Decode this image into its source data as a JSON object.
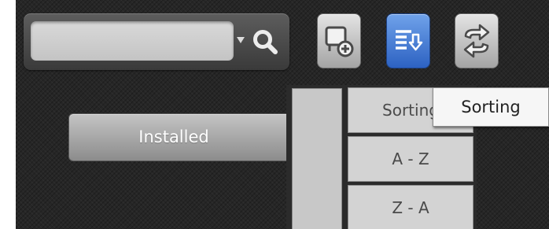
{
  "search": {
    "value": "",
    "placeholder": "",
    "icon": "search-icon",
    "dropdown_icon": "chevron-down-icon"
  },
  "toolbar": {
    "buttons": [
      {
        "icon": "add-window-icon",
        "style": "grey"
      },
      {
        "icon": "sort-list-icon",
        "style": "blue",
        "active": true
      },
      {
        "icon": "swap-arrows-icon",
        "style": "grey"
      }
    ]
  },
  "filter": {
    "installed_label": "Installed"
  },
  "sort_menu": {
    "header": "Sorting",
    "items": [
      "A - Z",
      "Z - A"
    ]
  },
  "tooltip": {
    "text": "Sorting"
  },
  "colors": {
    "background": "#262626",
    "active_button": "#3d74d4",
    "button_grey": "#c2c2c2",
    "menu_item": "#d3d3d3"
  }
}
